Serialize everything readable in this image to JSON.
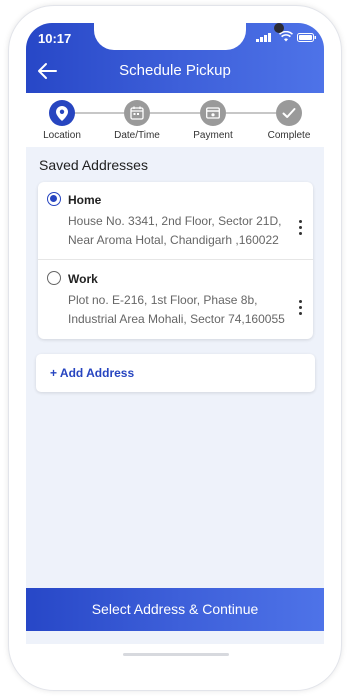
{
  "status_bar": {
    "time": "10:17"
  },
  "header": {
    "title": "Schedule Pickup"
  },
  "stepper": {
    "steps": [
      {
        "label": "Location",
        "icon": "location-pin-icon",
        "active": true
      },
      {
        "label": "Date/Time",
        "icon": "calendar-icon",
        "active": false
      },
      {
        "label": "Payment",
        "icon": "payment-icon",
        "active": false
      },
      {
        "label": "Complete",
        "icon": "checkmark-icon",
        "active": false
      }
    ]
  },
  "saved_addresses": {
    "title": "Saved Addresses",
    "items": [
      {
        "name": "Home",
        "line1": "House No. 3341, 2nd Floor, Sector 21D,",
        "line2": "Near Aroma Hotal, Chandigarh ,160022",
        "selected": true
      },
      {
        "name": "Work",
        "line1": "Plot no. E-216, 1st Floor, Phase 8b,",
        "line2": "Industrial Area Mohali, Sector 74,160055",
        "selected": false
      }
    ]
  },
  "add_address": {
    "label": "+ Add Address"
  },
  "cta": {
    "label": "Select Address & Continue"
  },
  "colors": {
    "primary": "#2745c0",
    "accent": "#4e73e8",
    "background": "#eef2fa"
  }
}
